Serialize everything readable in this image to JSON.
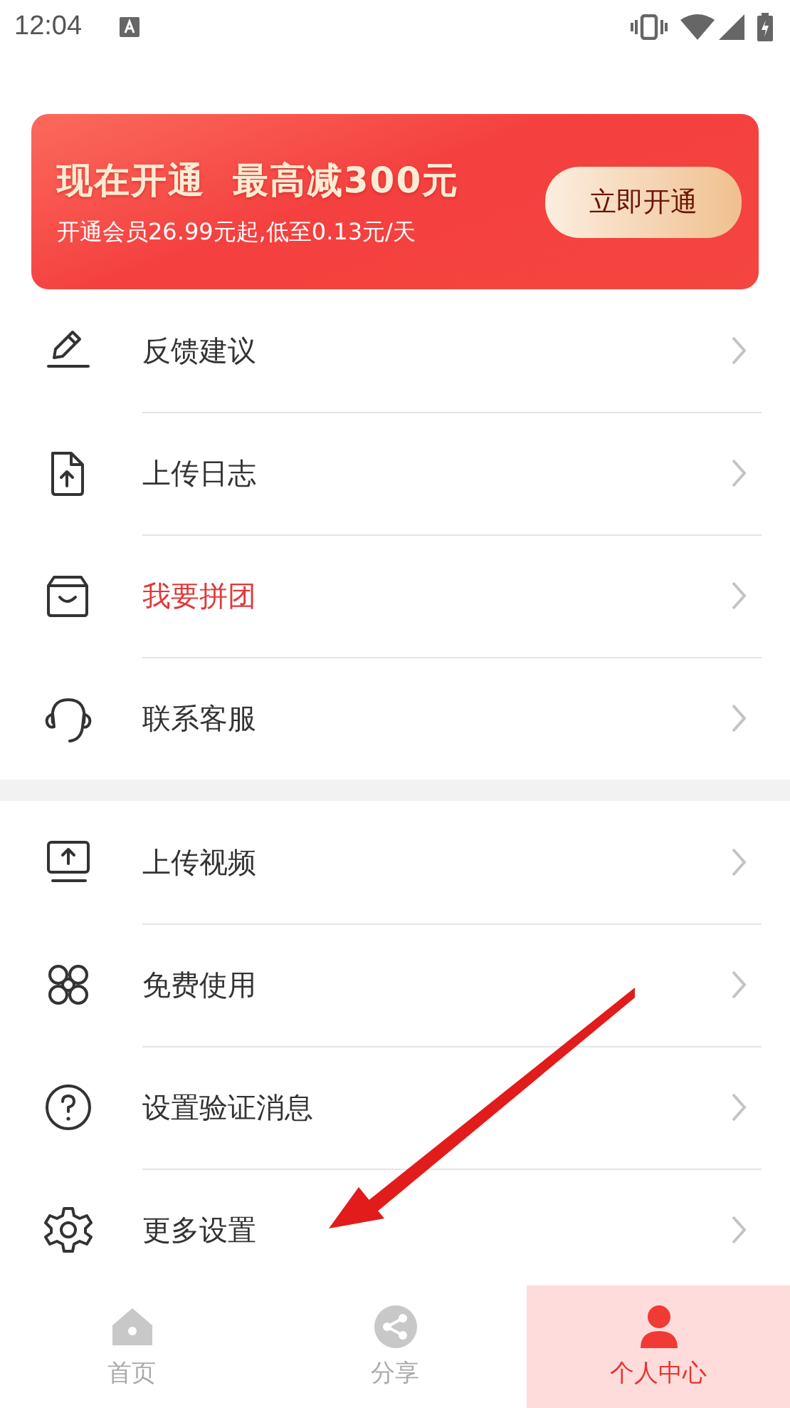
{
  "status_bar": {
    "time": "12:04"
  },
  "banner": {
    "title": "现在开通  最高减300元",
    "subtitle": "开通会员26.99元起,低至0.13元/天",
    "button": "立即开通"
  },
  "sections": [
    {
      "items": [
        {
          "label": "反馈建议",
          "highlighted": false
        },
        {
          "label": "上传日志",
          "highlighted": false
        },
        {
          "label": "我要拼团",
          "highlighted": true
        },
        {
          "label": "联系客服",
          "highlighted": false
        }
      ]
    },
    {
      "items": [
        {
          "label": "上传视频",
          "highlighted": false
        },
        {
          "label": "免费使用",
          "highlighted": false
        },
        {
          "label": "设置验证消息",
          "highlighted": false
        },
        {
          "label": "更多设置",
          "highlighted": false
        }
      ]
    }
  ],
  "tabs": [
    {
      "label": "首页",
      "selected": false
    },
    {
      "label": "分享",
      "selected": false
    },
    {
      "label": "个人中心",
      "selected": true
    }
  ]
}
